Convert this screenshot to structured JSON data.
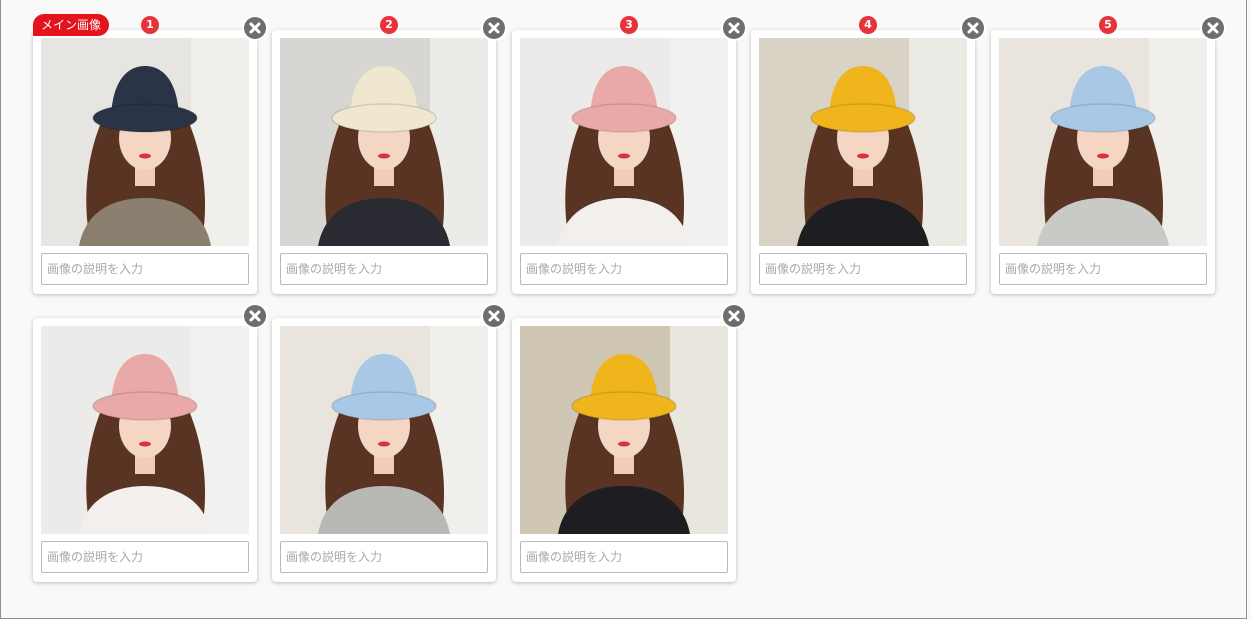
{
  "main_badge": "メイン画像",
  "placeholder": "画像の説明を入力",
  "images": [
    {
      "number": "1",
      "hat_color": "#2b3346",
      "bg": "#e7e5e1",
      "top_color": "#8b8070"
    },
    {
      "number": "2",
      "hat_color": "#efe7d0",
      "bg": "#d8d6d2",
      "top_color": "#2a2a33"
    },
    {
      "number": "3",
      "hat_color": "#e8a9a8",
      "bg": "#ecebe9",
      "top_color": "#f2efec"
    },
    {
      "number": "4",
      "hat_color": "#f0b51d",
      "bg": "#d9d3c6",
      "top_color": "#1d1d22"
    },
    {
      "number": "5",
      "hat_color": "#a9c8e6",
      "bg": "#e9e5de",
      "top_color": "#c9cac6"
    },
    {
      "number": "",
      "hat_color": "#e8a9a8",
      "bg": "#ecebe9",
      "top_color": "#f2efec"
    },
    {
      "number": "",
      "hat_color": "#a9c8e6",
      "bg": "#e9e5de",
      "top_color": "#b8b8b4"
    },
    {
      "number": "",
      "hat_color": "#f0b51d",
      "bg": "#cfc6b3",
      "top_color": "#1d1d22"
    }
  ]
}
